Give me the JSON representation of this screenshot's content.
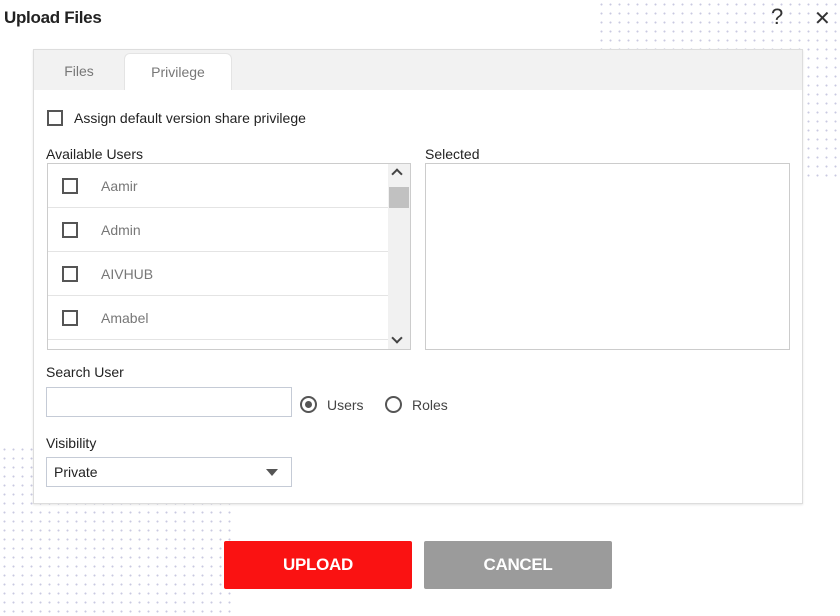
{
  "header": {
    "title": "Upload Files",
    "help_icon": "?",
    "close_icon": "✕"
  },
  "tabs": [
    {
      "label": "Files",
      "active": false
    },
    {
      "label": "Privilege",
      "active": true
    }
  ],
  "assign_default": {
    "label": "Assign default version share privilege",
    "checked": false
  },
  "available_users": {
    "label": "Available Users",
    "items": [
      "Aamir",
      "Admin",
      "AIVHUB",
      "Amabel"
    ]
  },
  "selected": {
    "label": "Selected"
  },
  "search": {
    "label": "Search User",
    "value": "",
    "options": [
      {
        "label": "Users",
        "checked": true
      },
      {
        "label": "Roles",
        "checked": false
      }
    ]
  },
  "visibility": {
    "label": "Visibility",
    "value": "Private"
  },
  "buttons": {
    "upload": "UPLOAD",
    "cancel": "CANCEL"
  },
  "colors": {
    "upload": "#fa1212",
    "cancel": "#9b9b9b"
  }
}
